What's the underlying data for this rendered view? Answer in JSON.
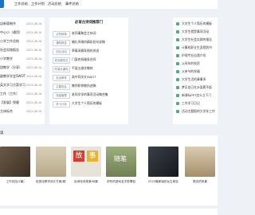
{
  "nav": [
    "工作总结",
    "工作计划",
    "活动总结",
    "事件总结"
  ],
  "left_list": [
    {
      "title": "店新版制作",
      "date": "2023-08-10"
    },
    {
      "title": "中心小（通用）",
      "date": "2023-08-10"
    },
    {
      "title": "小学工作总结",
      "date": "2023-08-10"
    },
    {
      "title": "社会实践报告",
      "date": "2023-08-10"
    },
    {
      "title": "小学教学",
      "date": "2023-08-10"
    },
    {
      "title": "团教学（分享）",
      "date": "2023-08-10"
    },
    {
      "title": "副教学学会SWOT",
      "date": "2023-08-10"
    },
    {
      "title": "英文学习方案学习",
      "date": "2023-08-10"
    },
    {
      "title": "工作（工作）",
      "date": "2023-08-10"
    },
    {
      "title": "【发展】保健",
      "date": "2023-08-10"
    },
    {
      "title": "主体标合",
      "date": "2023-08-10"
    }
  ],
  "middle": {
    "title": "必背古诗词推荐门",
    "rows": [
      {
        "tag": "记背故事",
        "text": "老同事聚会主持词"
      },
      {
        "tag": "通知报告",
        "text": "婚礼伴娘的精彩短句说稿"
      },
      {
        "tag": "创业活动",
        "text": "草莓采摘条围的说说"
      },
      {
        "tag": "发言稿范文",
        "text": "门面的祝福条合同"
      },
      {
        "tag": "防溺水通知",
        "text": "平面五维学教材"
      },
      {
        "tag": "安全教育",
        "text": "高中同学文SWOT"
      },
      {
        "tag": "主题班会",
        "text": "教师职称教科述稿"
      },
      {
        "tag": "班级管理",
        "text": "老同学学的事项活动稿合集"
      },
      {
        "tag": "学习计划",
        "text": "大学生个人简历的模板"
      }
    ]
  },
  "right_list": [
    "大学生个人简历的模板",
    "大学生就是事项活动",
    "大学生社会实践的报告",
    "计算机职业生涯规划书",
    "护理专业自我介绍",
    "父母年的祝愿",
    "父亲节的祝福",
    "大学生活的事事多",
    "梦见自己在水面爬不起",
    "新课标PPT怎么立下门",
    "工作学习日记",
    "活动主题报的大学年工作"
  ],
  "section_label": "读",
  "cards": [
    {
      "caption": "工作总结(2篇)",
      "color": "#5a4a3a"
    },
    {
      "caption": "信息化教学设计方案(精选)",
      "color": "#c4b89a"
    },
    {
      "caption": "民间传说故事38篇",
      "color": "#d63d2e"
    },
    {
      "caption": "好听的游戏名字男情侣",
      "color": "#8b9a6a"
    },
    {
      "caption": "2023最新版的女生网名500",
      "color": "#2a2f36"
    },
    {
      "caption": "周边的风景",
      "color": "#b8a88a"
    }
  ],
  "card_text": {
    "gushi_left": "故",
    "gushi_right": "事",
    "sui_left": "随",
    "sui_right": "笔"
  }
}
